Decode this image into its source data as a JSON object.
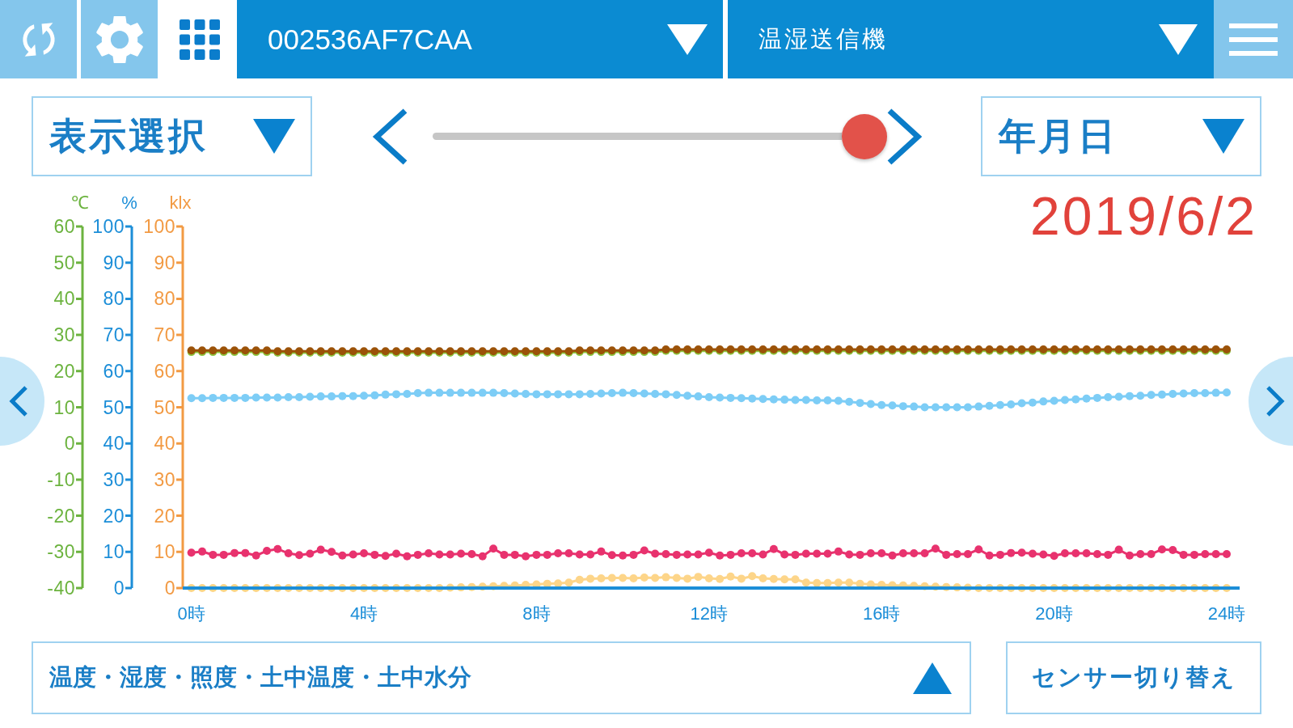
{
  "toolbar": {
    "tabs": [
      {
        "kind": "refresh",
        "selected": false
      },
      {
        "kind": "settings",
        "selected": false
      },
      {
        "kind": "grid",
        "selected": true
      }
    ],
    "device_id": "002536AF7CAA",
    "device_type": "温湿送信機"
  },
  "controls": {
    "display_select": "表示選択",
    "slider": {
      "level": 1
    },
    "range_select": "年月日"
  },
  "chart": {
    "date": "2019/6/2",
    "chart_data": {
      "type": "line",
      "marker": "circle",
      "ylabel": "℃",
      "y2label": "%",
      "y3label": "klx",
      "xlim": [
        -0.2,
        24.3
      ],
      "ylim": [
        -40,
        60
      ],
      "y2lim": [
        0,
        100
      ],
      "y3lim": [
        0,
        100
      ],
      "xticks": [
        {
          "value": 0,
          "label": "0時"
        },
        {
          "value": 4,
          "label": "4時"
        },
        {
          "value": 8,
          "label": "8時"
        },
        {
          "value": 12,
          "label": "12時"
        },
        {
          "value": 16,
          "label": "16時"
        },
        {
          "value": 20,
          "label": "20時"
        },
        {
          "value": 24,
          "label": "24時"
        }
      ],
      "yticks": [
        60,
        50,
        40,
        30,
        20,
        10,
        0,
        -10,
        -20,
        -30,
        -40
      ],
      "y2ticks": [
        100,
        90,
        80,
        70,
        60,
        50,
        40,
        30,
        20,
        10,
        0
      ],
      "y3ticks": [
        100,
        90,
        80,
        70,
        60,
        50,
        40,
        30,
        20,
        10,
        0
      ],
      "x": [
        0,
        0.25,
        0.5,
        0.75,
        1,
        1.25,
        1.5,
        1.75,
        2,
        2.25,
        2.5,
        2.75,
        3,
        3.25,
        3.5,
        3.75,
        4,
        4.25,
        4.5,
        4.75,
        5,
        5.25,
        5.5,
        5.75,
        6,
        6.25,
        6.5,
        6.75,
        7,
        7.25,
        7.5,
        7.75,
        8,
        8.25,
        8.5,
        8.75,
        9,
        9.25,
        9.5,
        9.75,
        10,
        10.25,
        10.5,
        10.75,
        11,
        11.25,
        11.5,
        11.75,
        12,
        12.25,
        12.5,
        12.75,
        13,
        13.25,
        13.5,
        13.75,
        14,
        14.25,
        14.5,
        14.75,
        15,
        15.25,
        15.5,
        15.75,
        16,
        16.25,
        16.5,
        16.75,
        17,
        17.25,
        17.5,
        17.75,
        18,
        18.25,
        18.5,
        18.75,
        19,
        19.25,
        19.5,
        19.75,
        20,
        20.25,
        20.5,
        20.75,
        21,
        21.25,
        21.5,
        21.75,
        22,
        22.25,
        22.5,
        22.75,
        23,
        23.25,
        23.5,
        23.75,
        24
      ],
      "series": [
        {
          "axis": "y",
          "color": "#8dc63f",
          "values": [
            25.3,
            25.3,
            25.3,
            25.3,
            25.3,
            25.3,
            25.3,
            25.3,
            25.1,
            25.1,
            25.1,
            25.1,
            25.1,
            25.1,
            25.1,
            25.1,
            25.1,
            25.1,
            25.1,
            25.1,
            25.1,
            25.1,
            25.1,
            25.1,
            25.1,
            25.1,
            25.1,
            25.1,
            25.1,
            25.1,
            25.1,
            25.1,
            25.1,
            25.1,
            25.1,
            25.1,
            25.3,
            25.3,
            25.3,
            25.3,
            25.3,
            25.3,
            25.3,
            25.3,
            25.6,
            25.6,
            25.6,
            25.6,
            25.6,
            25.6,
            25.6,
            25.6,
            25.6,
            25.6,
            25.6,
            25.6,
            25.6,
            25.6,
            25.6,
            25.6,
            25.6,
            25.6,
            25.6,
            25.6,
            25.6,
            25.6,
            25.6,
            25.6,
            25.6,
            25.6,
            25.6,
            25.6,
            25.6,
            25.6,
            25.6,
            25.6,
            25.6,
            25.6,
            25.6,
            25.6,
            25.6,
            25.6,
            25.6,
            25.6,
            25.6,
            25.6,
            25.6,
            25.6,
            25.6,
            25.6,
            25.6,
            25.6,
            25.6,
            25.6,
            25.6,
            25.6,
            25.6
          ]
        },
        {
          "axis": "y2",
          "color": "#7dcdf6",
          "values": [
            52.5,
            52.5,
            52.6,
            52.6,
            52.6,
            52.6,
            52.7,
            52.7,
            52.7,
            52.8,
            52.8,
            52.9,
            53,
            53,
            53.1,
            53.1,
            53.2,
            53.3,
            53.5,
            53.6,
            53.7,
            53.9,
            54,
            54,
            54,
            54,
            54,
            54,
            54,
            53.9,
            53.8,
            53.7,
            53.6,
            53.6,
            53.6,
            53.6,
            53.6,
            53.7,
            53.8,
            53.9,
            54,
            53.9,
            53.8,
            53.7,
            53.6,
            53.4,
            53.2,
            53,
            52.8,
            52.7,
            52.6,
            52.5,
            52.4,
            52.3,
            52.2,
            52.1,
            52,
            52,
            51.9,
            51.9,
            51.8,
            51.5,
            51.2,
            50.9,
            50.6,
            50.5,
            50.3,
            50.2,
            50,
            50,
            50,
            50,
            50,
            50.2,
            50.4,
            50.6,
            50.8,
            51.1,
            51.3,
            51.6,
            51.8,
            52,
            52.2,
            52.4,
            52.6,
            52.8,
            52.9,
            53.1,
            53.2,
            53.4,
            53.5,
            53.7,
            53.8,
            53.9,
            53.9,
            54,
            54.1
          ]
        },
        {
          "axis": "y3",
          "color": "#fdd589",
          "values": [
            0,
            0,
            0,
            0,
            0,
            0,
            0,
            0,
            0,
            0,
            0,
            0,
            0,
            0,
            0,
            0,
            0,
            0,
            0,
            0,
            0,
            0,
            0,
            0,
            0.1,
            0.2,
            0.3,
            0.4,
            0.5,
            0.6,
            0.7,
            0.9,
            1,
            1.2,
            1.3,
            1.5,
            2.3,
            2.6,
            2.7,
            2.8,
            2.8,
            2.7,
            2.9,
            2.8,
            3,
            2.8,
            2.6,
            3.1,
            2.7,
            2.5,
            3.2,
            2.6,
            3.3,
            2.7,
            2.5,
            2.4,
            2.4,
            1.5,
            1.4,
            1.4,
            1.5,
            1.5,
            1.2,
            1,
            0.9,
            0.8,
            0.7,
            0.6,
            0.5,
            0.4,
            0.3,
            0.2,
            0.1,
            0,
            0,
            0,
            0,
            0,
            0,
            0,
            0,
            0,
            0,
            0,
            0,
            0,
            0,
            0,
            0,
            0,
            0,
            0,
            0,
            0,
            0,
            0,
            0
          ]
        },
        {
          "axis": "y",
          "color": "#9b5208",
          "values": [
            25.7,
            25.7,
            25.7,
            25.7,
            25.7,
            25.7,
            25.7,
            25.7,
            25.5,
            25.5,
            25.5,
            25.5,
            25.5,
            25.5,
            25.5,
            25.5,
            25.5,
            25.5,
            25.5,
            25.5,
            25.5,
            25.5,
            25.5,
            25.5,
            25.5,
            25.5,
            25.5,
            25.5,
            25.5,
            25.5,
            25.5,
            25.5,
            25.5,
            25.5,
            25.5,
            25.5,
            25.7,
            25.7,
            25.7,
            25.7,
            25.7,
            25.7,
            25.7,
            25.7,
            26,
            26,
            26,
            26,
            26,
            26,
            26,
            26,
            26,
            26,
            26,
            26,
            26,
            26,
            26,
            26,
            26,
            26,
            26,
            26,
            26,
            26,
            26,
            26,
            26,
            26,
            26,
            26,
            26,
            26,
            26,
            26,
            26,
            26,
            26,
            26,
            26,
            26,
            26,
            26,
            26,
            26,
            26,
            26,
            26,
            26,
            26,
            26,
            26,
            26,
            26,
            26,
            26
          ]
        },
        {
          "axis": "y2",
          "color": "#e8326e",
          "values": [
            9.8,
            10.1,
            9.2,
            9.2,
            9.7,
            9.7,
            9,
            10.3,
            10.8,
            9.6,
            9.1,
            9.5,
            10.6,
            10,
            9,
            9.3,
            9.6,
            9.2,
            8.9,
            9.5,
            8.8,
            9.2,
            9.6,
            9.3,
            9.3,
            9.5,
            9.4,
            8.8,
            10.9,
            9.2,
            9.2,
            8.8,
            9.2,
            9.2,
            9.6,
            9.6,
            9.3,
            9.3,
            10.1,
            9.1,
            9,
            9.2,
            10.4,
            9.5,
            9.4,
            9.2,
            9.3,
            9.3,
            9.8,
            9,
            9.2,
            9.6,
            9.6,
            9.3,
            10.8,
            9.3,
            9.2,
            9.5,
            9.5,
            9.5,
            10.1,
            9.3,
            9.2,
            9.6,
            9.6,
            9,
            9.6,
            9.6,
            9.6,
            10.9,
            9.2,
            9.4,
            9.4,
            10.7,
            9,
            9.2,
            9.7,
            9.8,
            9.5,
            9.3,
            8.9,
            9.6,
            9.6,
            9.6,
            9.4,
            9.2,
            10.6,
            9,
            9.4,
            9.4,
            10.7,
            10.5,
            9.2,
            9.2,
            9.4,
            9.4,
            9.4
          ]
        }
      ]
    }
  },
  "footer": {
    "sensors": "温度・湿度・照度・土中温度・土中水分",
    "switch_button": "センサー切り替え"
  }
}
